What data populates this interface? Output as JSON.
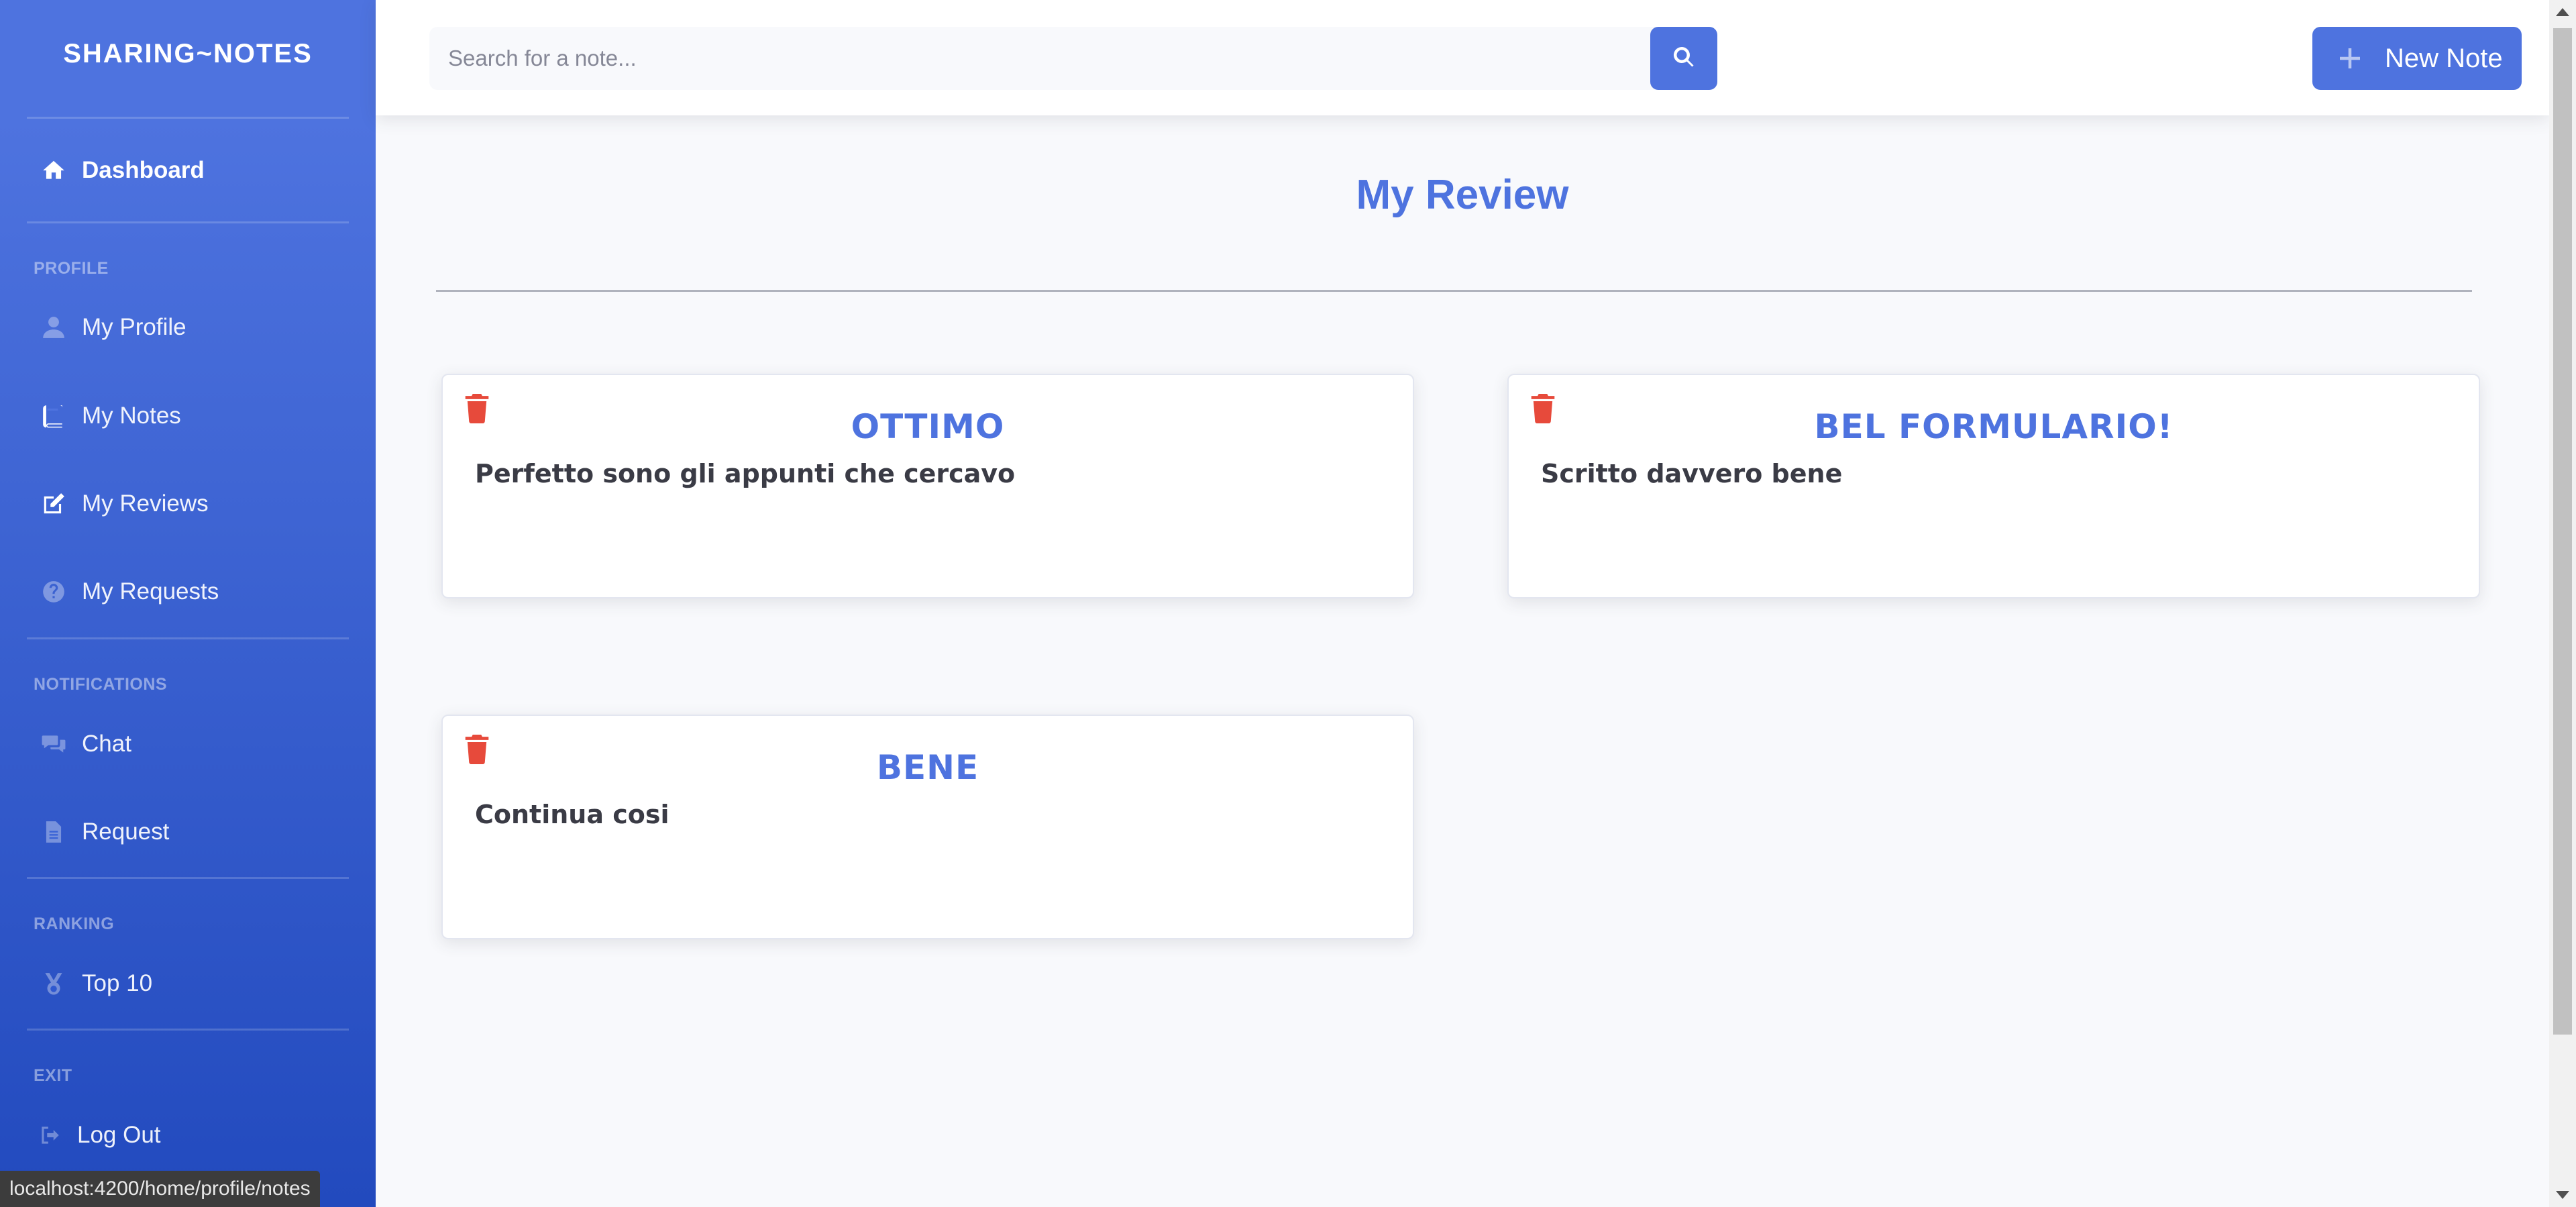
{
  "sidebar": {
    "brand": "SHARING~NOTES",
    "dashboard": "Dashboard",
    "sections": {
      "profile": "PROFILE",
      "notifications": "NOTIFICATIONS",
      "ranking": "RANKING",
      "exit": "EXIT"
    },
    "items": {
      "my_profile": "My Profile",
      "my_notes": "My Notes",
      "my_reviews": "My Reviews",
      "my_requests": "My Requests",
      "chat": "Chat",
      "request": "Request",
      "top10": "Top 10",
      "logout": "Log Out"
    },
    "icons": {
      "dashboard": "home-icon",
      "my_profile": "user-icon",
      "my_notes": "book-icon",
      "my_reviews": "edit-icon",
      "my_requests": "question-circle-icon",
      "chat": "comments-icon",
      "request": "file-icon",
      "top10": "medal-icon",
      "logout": "sign-out-icon"
    }
  },
  "topbar": {
    "search_placeholder": "Search for a note...",
    "new_note_label": "New Note"
  },
  "main": {
    "title": "My Review",
    "reviews": [
      {
        "title": "OTTIMO",
        "text": "Perfetto sono gli appunti che cercavo"
      },
      {
        "title": "BEL FORMULARIO!",
        "text": "Scritto davvero bene"
      },
      {
        "title": "BENE",
        "text": "Continua cosi"
      }
    ]
  },
  "status_bar": {
    "url": "localhost:4200/home/profile/notes"
  },
  "colors": {
    "primary": "#4e73df",
    "sidebar_dark": "#224abe",
    "danger": "#e74a3b",
    "background": "#f8f9fc",
    "text_dark": "#3a3b45"
  }
}
